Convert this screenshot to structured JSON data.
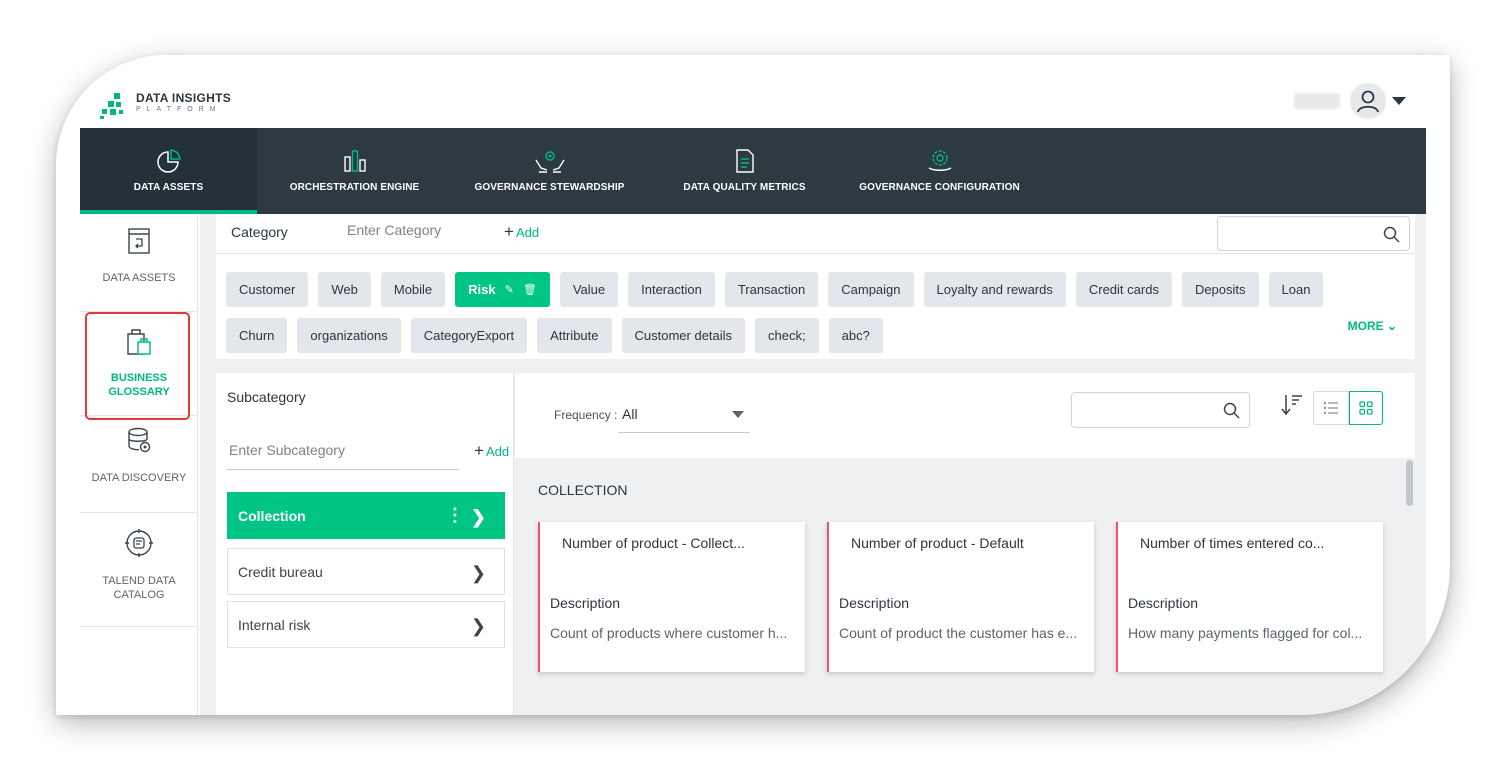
{
  "brand": {
    "title": "DATA INSIGHTS",
    "subtitle": "PLATFORM",
    "accent": "#00b882"
  },
  "nav": [
    {
      "label": "DATA ASSETS",
      "icon": "pie-chart-icon",
      "active": true
    },
    {
      "label": "ORCHESTRATION ENGINE",
      "icon": "bar-columns-icon"
    },
    {
      "label": "GOVERNANCE STEWARDSHIP",
      "icon": "hands-gear-icon"
    },
    {
      "label": "DATA QUALITY METRICS",
      "icon": "document-icon"
    },
    {
      "label": "GOVERNANCE CONFIGURATION",
      "icon": "gear-hand-icon"
    }
  ],
  "sidebar": [
    {
      "label": "DATA ASSETS",
      "icon": "data-assets-icon"
    },
    {
      "label": "BUSINESS GLOSSARY",
      "icon": "shopping-bag-icon",
      "active": true
    },
    {
      "label": "DATA DISCOVERY",
      "icon": "database-gear-icon"
    },
    {
      "label": "TALEND DATA CATALOG",
      "icon": "catalog-compass-icon"
    }
  ],
  "category": {
    "label": "Category",
    "placeholder": "Enter Category",
    "add_label": "Add",
    "more_label": "MORE",
    "row1": [
      "Customer",
      "Web",
      "Mobile",
      "Risk",
      "Value",
      "Interaction",
      "Transaction",
      "Campaign",
      "Loyalty and rewards",
      "Credit cards",
      "Deposits",
      "Loan"
    ],
    "row2": [
      "Churn",
      "organizations",
      "CategoryExport",
      "Attribute",
      "Customer details",
      "check;",
      "abc?"
    ],
    "active": "Risk"
  },
  "subcategory": {
    "title": "Subcategory",
    "placeholder": "Enter Subcategory",
    "add_label": "Add",
    "items": [
      "Collection",
      "Credit bureau",
      "Internal risk"
    ],
    "active": "Collection"
  },
  "filter": {
    "frequency_label": "Frequency :",
    "frequency_value": "All"
  },
  "collection_title": "COLLECTION",
  "cards": [
    {
      "title": "Number of product - Collect...",
      "desc_label": "Description",
      "desc": "Count of products where customer h..."
    },
    {
      "title": "Number of product - Default",
      "desc_label": "Description",
      "desc": "Count of product the customer has e..."
    },
    {
      "title": "Number of times entered co...",
      "desc_label": "Description",
      "desc": "How many payments flagged for col..."
    }
  ]
}
